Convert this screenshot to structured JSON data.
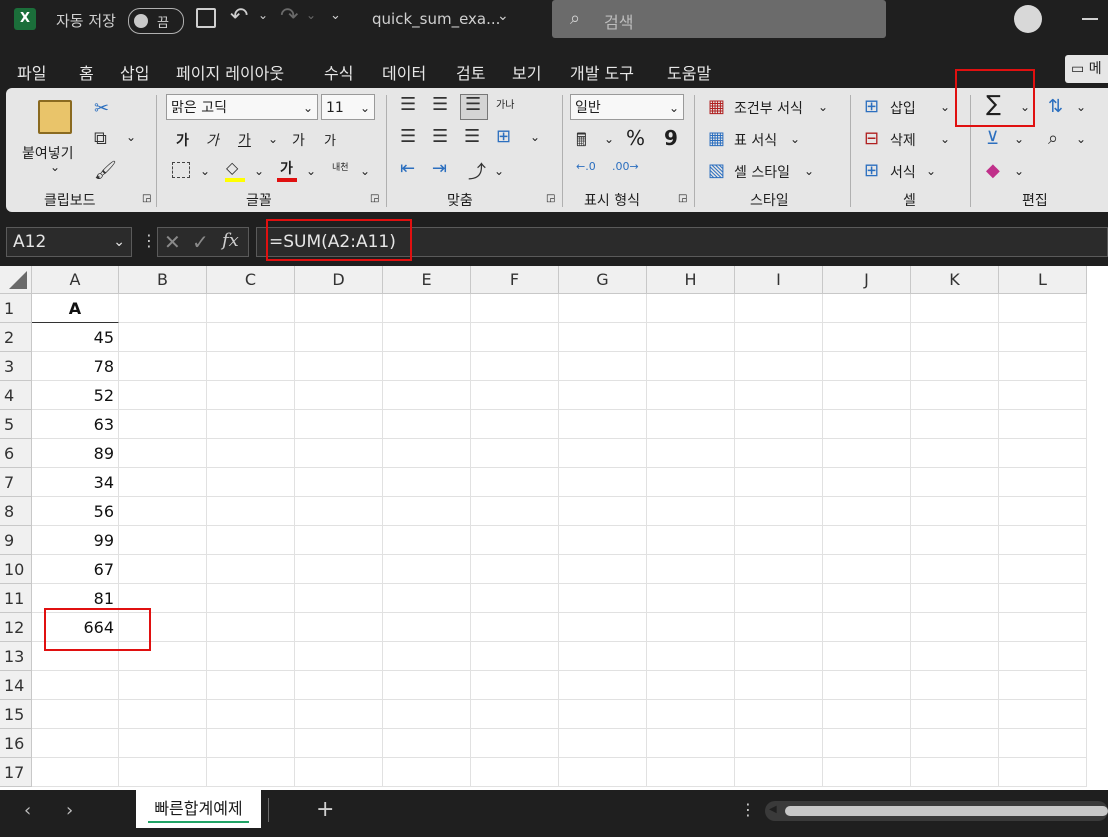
{
  "titlebar": {
    "autosave_label": "자동 저장",
    "autosave_state": "끔",
    "filename": "quick_sum_exa...",
    "search_placeholder": "검색"
  },
  "menu": {
    "tabs": [
      "파일",
      "홈",
      "삽입",
      "페이지 레이아웃",
      "수식",
      "데이터",
      "검토",
      "보기",
      "개발 도구",
      "도움말"
    ],
    "active": "홈",
    "comment_label": "메"
  },
  "ribbon": {
    "clipboard": {
      "paste_label": "붙여넣기",
      "group": "클립보드"
    },
    "font": {
      "name": "맑은 고딕",
      "size": "11",
      "group": "글꼴",
      "bold": "가",
      "italic": "가",
      "underline": "가",
      "grow": "가",
      "shrink": "가",
      "color_glyph": "가",
      "phonetic": "내천"
    },
    "alignment": {
      "group": "맞춤",
      "wrap": "가나"
    },
    "number": {
      "format": "일반",
      "group": "표시 형식",
      "percent": "%",
      "comma": "9"
    },
    "styles": {
      "conditional": "조건부 서식",
      "table": "표 서식",
      "cell": "셀 스타일",
      "group": "스타일"
    },
    "cells": {
      "insert": "삽입",
      "delete": "삭제",
      "format": "서식",
      "group": "셀"
    },
    "editing": {
      "autosum": "∑",
      "group": "편집"
    }
  },
  "formula_bar": {
    "name_box": "A12",
    "formula": "=SUM(A2:A11)"
  },
  "grid": {
    "columns": [
      "A",
      "B",
      "C",
      "D",
      "E",
      "F",
      "G",
      "H",
      "I",
      "J",
      "K",
      "L"
    ],
    "rows": [
      "1",
      "2",
      "3",
      "4",
      "5",
      "6",
      "7",
      "8",
      "9",
      "10",
      "11",
      "12",
      "13",
      "14",
      "15",
      "16",
      "17"
    ],
    "A1": "A",
    "values": [
      "45",
      "78",
      "52",
      "63",
      "89",
      "34",
      "56",
      "99",
      "67",
      "81"
    ],
    "sum": "664"
  },
  "sheets": {
    "tabs": [
      "빠른합계예제"
    ],
    "add": "+"
  }
}
